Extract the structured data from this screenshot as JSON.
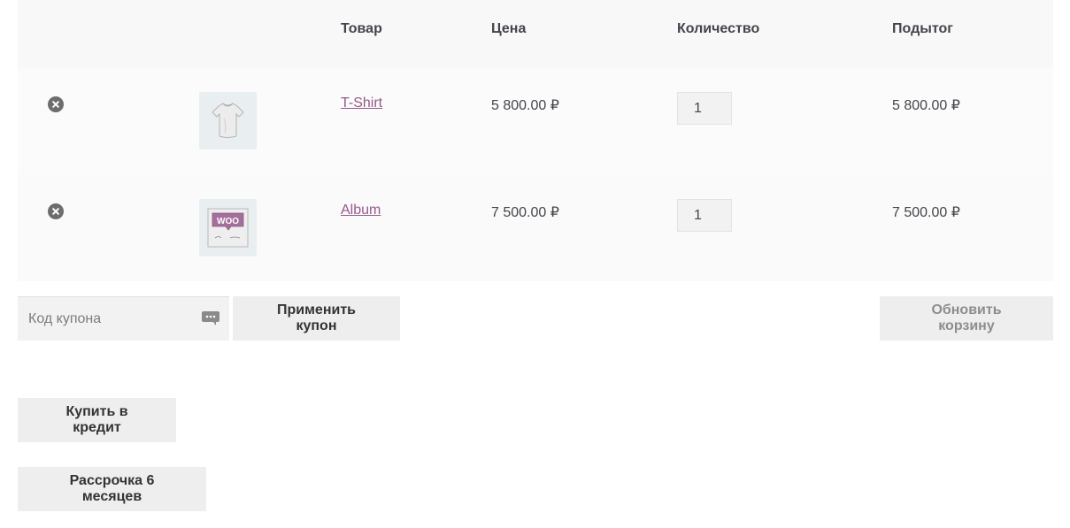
{
  "table": {
    "headers": {
      "remove": "",
      "thumbnail": "",
      "product": "Товар",
      "price": "Цена",
      "quantity": "Количество",
      "subtotal": "Подытог"
    },
    "items": [
      {
        "name": "T-Shirt",
        "price": "5 800.00 ₽",
        "quantity": "1",
        "subtotal": "5 800.00 ₽",
        "thumbnail_icon": "tshirt-thumbnail"
      },
      {
        "name": "Album",
        "price": "7 500.00 ₽",
        "quantity": "1",
        "subtotal": "7 500.00 ₽",
        "thumbnail_icon": "woo-album-thumbnail",
        "logo_text": "WOO"
      }
    ]
  },
  "coupon": {
    "placeholder": "Код купона",
    "apply_label": "Применить купон",
    "icon": "password-manager-icon"
  },
  "update_cart_label": "Обновить корзину",
  "buy_on_credit_label": "Купить в кредит",
  "installment_label": "Рассрочка 6 месяцев",
  "colors": {
    "link": "#96588a",
    "button_bg": "#eeeeee",
    "row_bg": "#fafafa",
    "header_bg": "#f8f8f8"
  }
}
